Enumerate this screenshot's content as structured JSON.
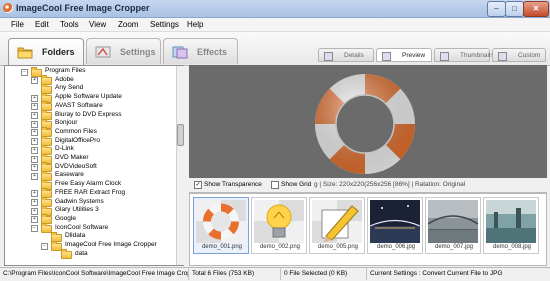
{
  "window": {
    "title": "ImageCool Free Image Cropper",
    "minimize_glyph": "–",
    "maximize_glyph": "□",
    "close_glyph": "✕"
  },
  "menu": [
    {
      "label": "File"
    },
    {
      "label": "Edit"
    },
    {
      "label": "Tools"
    },
    {
      "label": "View"
    },
    {
      "label": "Zoom"
    },
    {
      "label": "Settings"
    },
    {
      "label": "Help"
    }
  ],
  "main_tabs": [
    {
      "label": "Folders",
      "icon": "folders-icon"
    },
    {
      "label": "Settings",
      "icon": "settings-icon"
    },
    {
      "label": "Effects",
      "icon": "effects-icon"
    }
  ],
  "view_tabs": [
    {
      "label": "Details",
      "icon": "details-icon"
    },
    {
      "label": "Preview",
      "icon": "preview-icon"
    },
    {
      "label": "Thumbnails",
      "icon": "thumbnails-icon"
    },
    {
      "label": "Custom",
      "icon": "custom-icon"
    }
  ],
  "tree": [
    {
      "label": "Program Files",
      "level": 0,
      "expander": "−"
    },
    {
      "label": "Adobe",
      "level": 1,
      "expander": "+"
    },
    {
      "label": "Any Send",
      "level": 1,
      "expander": ""
    },
    {
      "label": "Apple Software Update",
      "level": 1,
      "expander": "+"
    },
    {
      "label": "AVAST Software",
      "level": 1,
      "expander": "+"
    },
    {
      "label": "Bluray to DVD Express",
      "level": 1,
      "expander": "+"
    },
    {
      "label": "Bonjour",
      "level": 1,
      "expander": "+"
    },
    {
      "label": "Common Files",
      "level": 1,
      "expander": "+"
    },
    {
      "label": "DigitalOfficePro",
      "level": 1,
      "expander": "+"
    },
    {
      "label": "D-Link",
      "level": 1,
      "expander": "+"
    },
    {
      "label": "DVD Maker",
      "level": 1,
      "expander": "+"
    },
    {
      "label": "DVDVideoSoft",
      "level": 1,
      "expander": "+"
    },
    {
      "label": "Easeware",
      "level": 1,
      "expander": "+"
    },
    {
      "label": "Free Easy Alarm Clock",
      "level": 1,
      "expander": ""
    },
    {
      "label": "FREE RAR Extract Frog",
      "level": 1,
      "expander": "+"
    },
    {
      "label": "Gadwin Systems",
      "level": 1,
      "expander": "+"
    },
    {
      "label": "Glary Utilities 3",
      "level": 1,
      "expander": "+"
    },
    {
      "label": "Google",
      "level": 1,
      "expander": "+"
    },
    {
      "label": "IconCool Software",
      "level": 1,
      "expander": "−"
    },
    {
      "label": "Dlldata",
      "level": 2,
      "expander": ""
    },
    {
      "label": "ImageCool Free Image Cropper",
      "level": 2,
      "expander": "−"
    },
    {
      "label": "data",
      "level": 3,
      "expander": ""
    }
  ],
  "preview": {
    "show_transparence_label": "Show Transparence",
    "show_transparence_checked": true,
    "show_grid_label": "Show Grid",
    "show_grid_checked": false,
    "image_info": "g | Size: 220x220(256x256 [86%] | Ratation: Original"
  },
  "thumbnails": [
    {
      "caption": "demo_001.png",
      "selected": true,
      "kind": "ring"
    },
    {
      "caption": "demo_002.png",
      "selected": false,
      "kind": "bulb"
    },
    {
      "caption": "demo_005.png",
      "selected": false,
      "kind": "pencil"
    },
    {
      "caption": "demo_006.jpg",
      "selected": false,
      "kind": "night"
    },
    {
      "caption": "demo_007.jpg",
      "selected": false,
      "kind": "bridge"
    },
    {
      "caption": "demo_008.jpg",
      "selected": false,
      "kind": "harbor"
    }
  ],
  "status": {
    "path": "C:\\Program Files\\IconCool Software\\ImageCool Free Image Cropper",
    "total": "Total 6 Files (753 KB)",
    "selected": "0 File Selected (0 KB)",
    "settings": "Current Settings : Convert Current File to JPG"
  },
  "colors": {
    "ring_orange": "#e8702c",
    "ring_white": "#f5f5f5",
    "preview_bg": "#6b6b6b"
  }
}
